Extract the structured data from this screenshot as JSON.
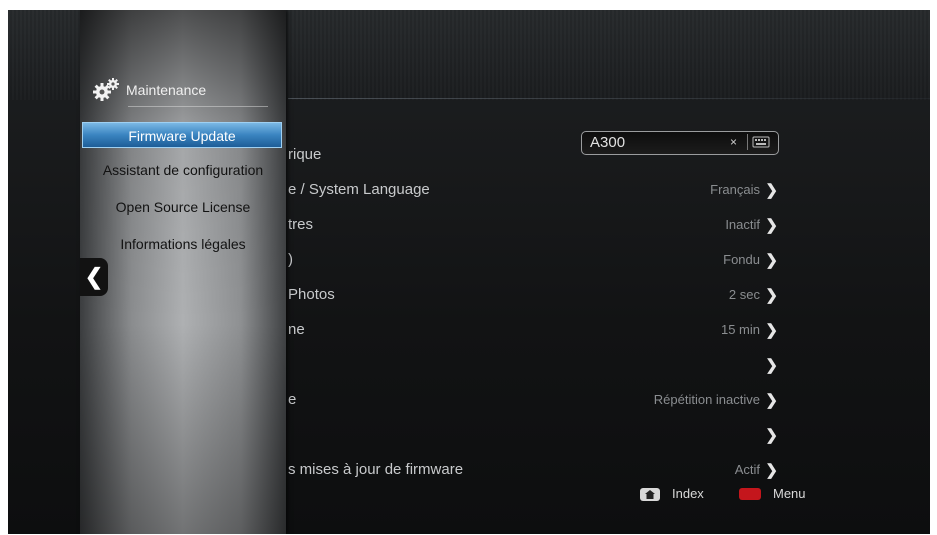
{
  "sidebar": {
    "title": "Maintenance",
    "header_icon": "gear-icon",
    "items": [
      {
        "label": "Firmware Update",
        "selected": true
      },
      {
        "label": "Assistant de configuration",
        "selected": false
      },
      {
        "label": "Open Source License",
        "selected": false
      },
      {
        "label": "Informations légales",
        "selected": false
      }
    ],
    "back_glyph": "❮"
  },
  "device_name": {
    "label": "rique",
    "value": "A300",
    "clear_glyph": "×",
    "keyboard_icon": "keyboard-icon"
  },
  "settings": [
    {
      "label": "e / System Language",
      "value": "Français"
    },
    {
      "label": "tres",
      "value": "Inactif"
    },
    {
      "label": ")",
      "value": "Fondu"
    },
    {
      "label": "Photos",
      "value": "2 sec"
    },
    {
      "label": "ne",
      "value": "15 min"
    },
    {
      "label": "",
      "value": ""
    },
    {
      "label": "e",
      "value": "Répétition inactive"
    },
    {
      "label": "",
      "value": ""
    },
    {
      "label": "s mises à jour de firmware",
      "value": "Actif"
    }
  ],
  "chevron_glyph": "❯",
  "footer": {
    "index_label": "Index",
    "menu_label": "Menu",
    "home_icon": "home-icon",
    "red_key_color": "#c4161c"
  },
  "colors": {
    "selection_blue": "#3a84c0",
    "background": "#141516"
  }
}
